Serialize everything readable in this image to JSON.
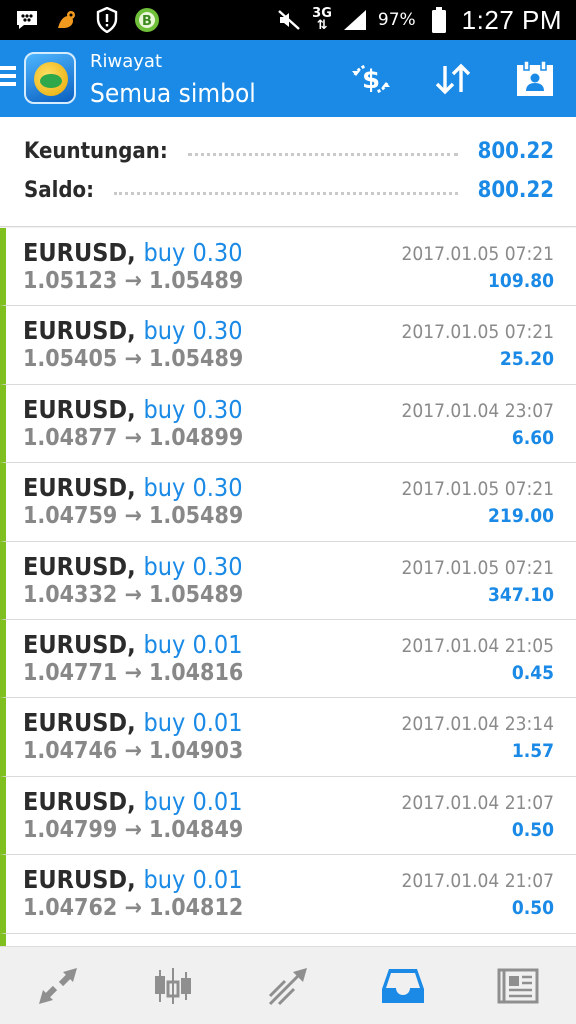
{
  "status_bar": {
    "icons": [
      "bbm-icon",
      "uc-browser-icon",
      "shield-alert-icon",
      "b-app-icon"
    ],
    "network": "3G",
    "battery": "97%",
    "time": "1:27 PM"
  },
  "toolbar": {
    "subtitle": "Riwayat",
    "title": "Semua simbol",
    "actions": [
      "dollar-sync-icon",
      "sort-icon",
      "calendar-icon"
    ]
  },
  "summary": {
    "profit_label": "Keuntungan:",
    "profit_value": "800.22",
    "balance_label": "Saldo:",
    "balance_value": "800.22"
  },
  "trades": [
    {
      "symbol": "EURUSD",
      "side": "buy 0.30",
      "open": "1.05123",
      "close": "1.05489",
      "time": "2017.01.05 07:21",
      "profit": "109.80"
    },
    {
      "symbol": "EURUSD",
      "side": "buy 0.30",
      "open": "1.05405",
      "close": "1.05489",
      "time": "2017.01.05 07:21",
      "profit": "25.20"
    },
    {
      "symbol": "EURUSD",
      "side": "buy 0.30",
      "open": "1.04877",
      "close": "1.04899",
      "time": "2017.01.04 23:07",
      "profit": "6.60"
    },
    {
      "symbol": "EURUSD",
      "side": "buy 0.30",
      "open": "1.04759",
      "close": "1.05489",
      "time": "2017.01.05 07:21",
      "profit": "219.00"
    },
    {
      "symbol": "EURUSD",
      "side": "buy 0.30",
      "open": "1.04332",
      "close": "1.05489",
      "time": "2017.01.05 07:21",
      "profit": "347.10"
    },
    {
      "symbol": "EURUSD",
      "side": "buy 0.01",
      "open": "1.04771",
      "close": "1.04816",
      "time": "2017.01.04 21:05",
      "profit": "0.45"
    },
    {
      "symbol": "EURUSD",
      "side": "buy 0.01",
      "open": "1.04746",
      "close": "1.04903",
      "time": "2017.01.04 23:14",
      "profit": "1.57"
    },
    {
      "symbol": "EURUSD",
      "side": "buy 0.01",
      "open": "1.04799",
      "close": "1.04849",
      "time": "2017.01.04 21:07",
      "profit": "0.50"
    },
    {
      "symbol": "EURUSD",
      "side": "buy 0.01",
      "open": "1.04762",
      "close": "1.04812",
      "time": "2017.01.04 21:07",
      "profit": "0.50"
    }
  ],
  "arrow": "→",
  "bottom_nav": [
    "quotes-icon",
    "chart-icon",
    "trade-icon",
    "history-icon",
    "news-icon"
  ],
  "colors": {
    "accent": "#1a8ae6",
    "buy_marker": "#7fbf1f"
  }
}
